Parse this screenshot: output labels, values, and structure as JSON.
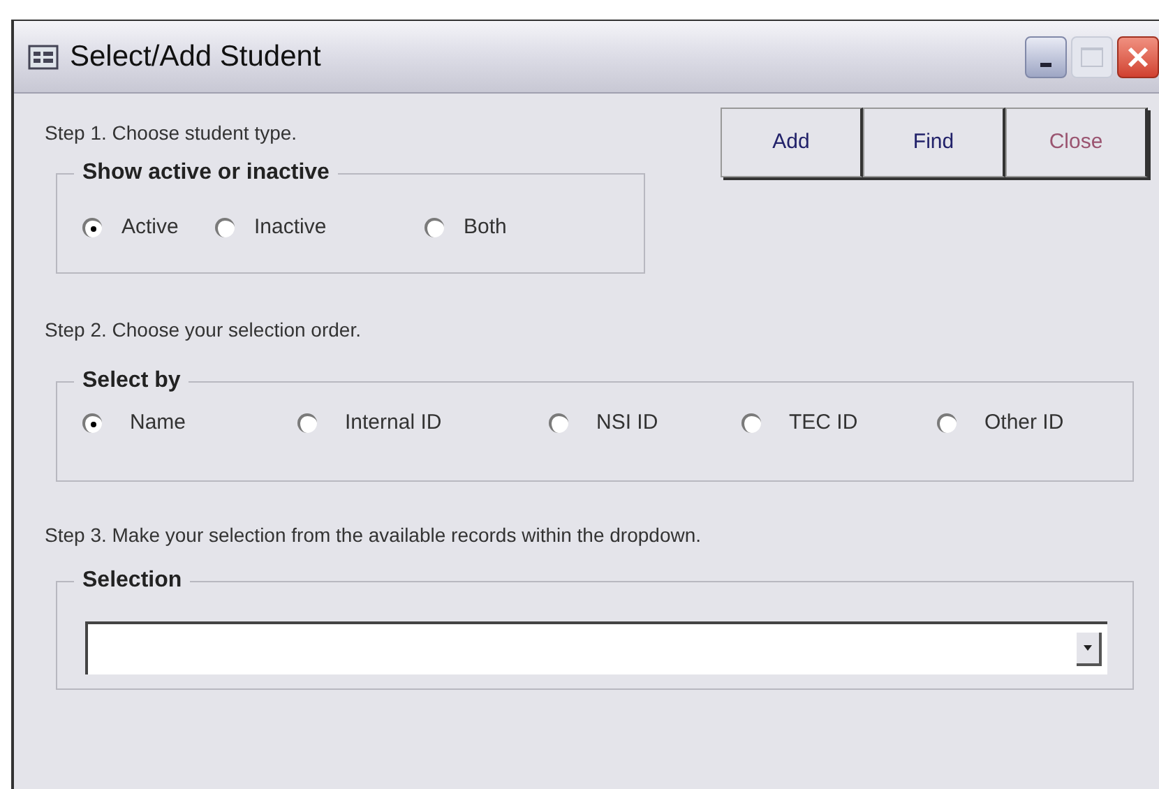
{
  "window": {
    "title": "Select/Add Student"
  },
  "buttons": [
    {
      "label": "Add",
      "kind": "normal"
    },
    {
      "label": "Find",
      "kind": "normal"
    },
    {
      "label": "Close",
      "kind": "close"
    }
  ],
  "step1": {
    "instruction": "Step 1. Choose student type.",
    "group_title": "Show active or inactive",
    "options": [
      {
        "label": "Active",
        "selected": true
      },
      {
        "label": "Inactive",
        "selected": false
      },
      {
        "label": "Both",
        "selected": false
      }
    ]
  },
  "step2": {
    "instruction": "Step 2. Choose your selection order.",
    "group_title": "Select by",
    "options": [
      {
        "label": "Name",
        "selected": true
      },
      {
        "label": "Internal ID",
        "selected": false
      },
      {
        "label": "NSI ID",
        "selected": false
      },
      {
        "label": "TEC ID",
        "selected": false
      },
      {
        "label": "Other ID",
        "selected": false
      }
    ]
  },
  "step3": {
    "instruction": "Step 3. Make your selection from the available records within the dropdown.",
    "group_title": "Selection"
  }
}
